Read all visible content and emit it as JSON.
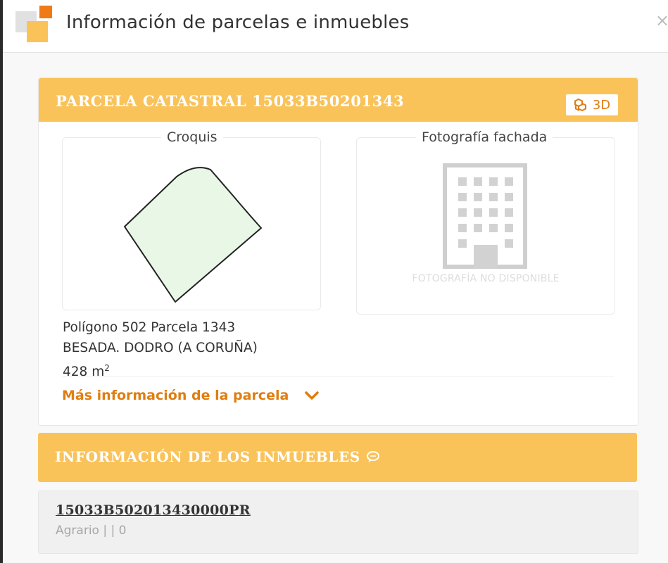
{
  "window": {
    "title": "Información de parcelas e inmuebles",
    "close_glyph": "×",
    "logo_icon": "catastro-logo-icon"
  },
  "colors": {
    "accent_bar": "#f9c35a",
    "accent_text": "#e07d10",
    "sketch_fill": "#e9f8e6",
    "placeholder_gray": "#cfcfcf"
  },
  "parcel": {
    "header": "PARCELA CATASTRAL 15033B50201343",
    "btn_3d_label": "3D",
    "btn_3d_icon": "cubes-icon",
    "croquis_label": "Croquis",
    "photo_label": "Fotografía fachada",
    "photo_unavailable": "FOTOGRAFÍA NO DISPONIBLE",
    "location": "Polígono 502 Parcela 1343",
    "address": "BESADA. DODRO (A CORUÑA)",
    "area_value": "428 m",
    "area_exp": "2",
    "more_info_label": "Más información de la parcela",
    "more_info_icon": "chevron-down-icon"
  },
  "buildings": {
    "header": "INFORMACIÓN DE LOS INMUEBLES",
    "header_icon": "chat-bubble-icon",
    "items": [
      {
        "ref": "15033B502013430000PR",
        "detail": "Agrario | | 0"
      }
    ]
  }
}
